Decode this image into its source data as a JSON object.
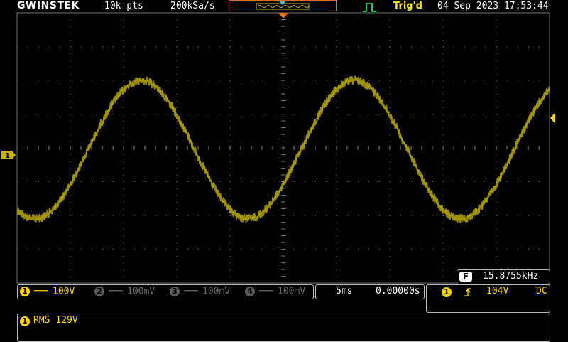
{
  "header": {
    "brand": "GWINSTEK",
    "record_length": "10k pts",
    "sample_rate": "200kSa/s",
    "trigger_status": "Trig'd",
    "datetime": "04 Sep 2023 17:53:44"
  },
  "colors": {
    "ch1": "#c9b200",
    "ch1_trace": "#9a8c00",
    "inactive": "#6a6a6a",
    "trigger_marker": "#f07020",
    "grid": "#6f6f6f",
    "status_green": "#33ff66",
    "status_yellow": "#ffe400"
  },
  "icons": {
    "trigger_edge": "rising-edge-icon",
    "ch1_marker": "channel-1-marker-icon",
    "trigger_level": "trigger-level-marker-icon",
    "trigger_position": "trigger-position-marker-icon"
  },
  "frequency": {
    "badge": "F",
    "value": "15.8755kHz"
  },
  "channels": [
    {
      "num": "1",
      "scale": "100V",
      "active": true
    },
    {
      "num": "2",
      "scale": "100mV",
      "active": false
    },
    {
      "num": "3",
      "scale": "100mV",
      "active": false
    },
    {
      "num": "4",
      "scale": "100mV",
      "active": false
    }
  ],
  "timebase": {
    "scale": "5ms",
    "position": "0.00000s"
  },
  "trigger": {
    "source": "1",
    "level": "104V",
    "coupling": "DC"
  },
  "measurement": {
    "channel": "1",
    "text": "RMS 129V"
  },
  "chart_data": {
    "type": "line",
    "series": [
      {
        "values_description_free": true
      }
    ],
    "waveform": {
      "shape": "sine",
      "cycles_on_screen": 2.5,
      "phase_start_deg": -120,
      "amplitude_divisions": 2.05,
      "offset_divisions": 0.05,
      "noise_divisions": 0.12
    },
    "divisions": {
      "x": 10,
      "y": 8
    },
    "grid": true
  }
}
